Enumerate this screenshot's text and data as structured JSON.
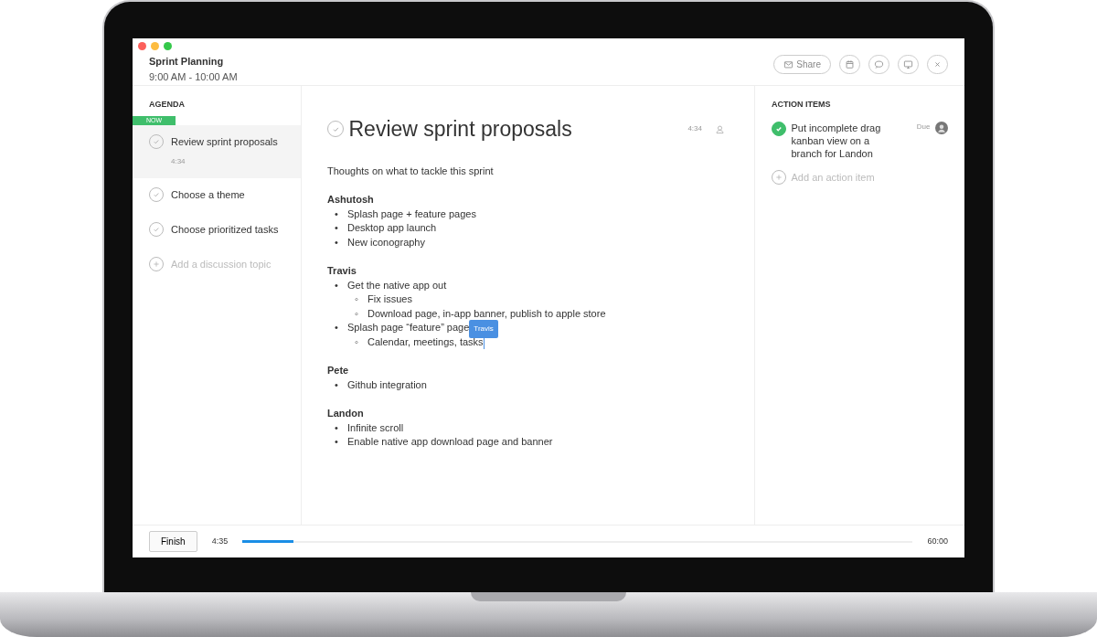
{
  "window": {
    "title": "Sprint Planning",
    "time": "9:00 AM - 10:00 AM"
  },
  "toolbar": [
    {
      "kind": "share",
      "label": "Share"
    },
    {
      "kind": "calendar"
    },
    {
      "kind": "chat"
    },
    {
      "kind": "monitor"
    },
    {
      "kind": "close"
    }
  ],
  "agenda": {
    "heading": "AGENDA",
    "now_label": "NOW",
    "items": [
      {
        "label": "Review sprint proposals",
        "time": "4:34",
        "selected": true
      },
      {
        "label": "Choose a theme",
        "selected": false
      },
      {
        "label": "Choose prioritized tasks",
        "selected": false
      }
    ],
    "add_placeholder": "Add a discussion topic"
  },
  "topic": {
    "title": "Review sprint proposals",
    "time": "4:34",
    "intro": "Thoughts on what to tackle this sprint",
    "sections": [
      {
        "heading": "Ashutosh",
        "items": [
          {
            "marker": "•",
            "text": "Splash page + feature pages"
          },
          {
            "marker": "•",
            "text": "Desktop app launch"
          },
          {
            "marker": "•",
            "text": "New iconography"
          }
        ]
      },
      {
        "heading": "Travis",
        "items": [
          {
            "marker": "•",
            "text": "Get the native app out",
            "children": [
              {
                "marker": "◦",
                "text": "Fix issues"
              },
              {
                "marker": "◦",
                "text": "Download page, in-app banner, publish to apple store"
              }
            ]
          },
          {
            "marker": "•",
            "text": "Splash page “feature” page",
            "cursor": "Travis",
            "children": [
              {
                "marker": "◦",
                "text": "Calendar, meetings, tasks",
                "caret": true
              }
            ]
          }
        ]
      },
      {
        "heading": "Pete",
        "items": [
          {
            "marker": "•",
            "text": "Github integration"
          }
        ]
      },
      {
        "heading": "Landon",
        "items": [
          {
            "marker": "•",
            "text": "Infinite scroll"
          },
          {
            "marker": "•",
            "text": "Enable native app download page and banner"
          }
        ]
      }
    ]
  },
  "action_items": {
    "heading": "ACTION ITEMS",
    "items": [
      {
        "text": "Put incomplete drag kanban view on a branch for Landon",
        "done": true,
        "due": "Due"
      }
    ],
    "add_placeholder": "Add an action item"
  },
  "footer": {
    "button": "Finish",
    "elapsed": "4:35",
    "total": "60:00",
    "level": 0.076
  }
}
